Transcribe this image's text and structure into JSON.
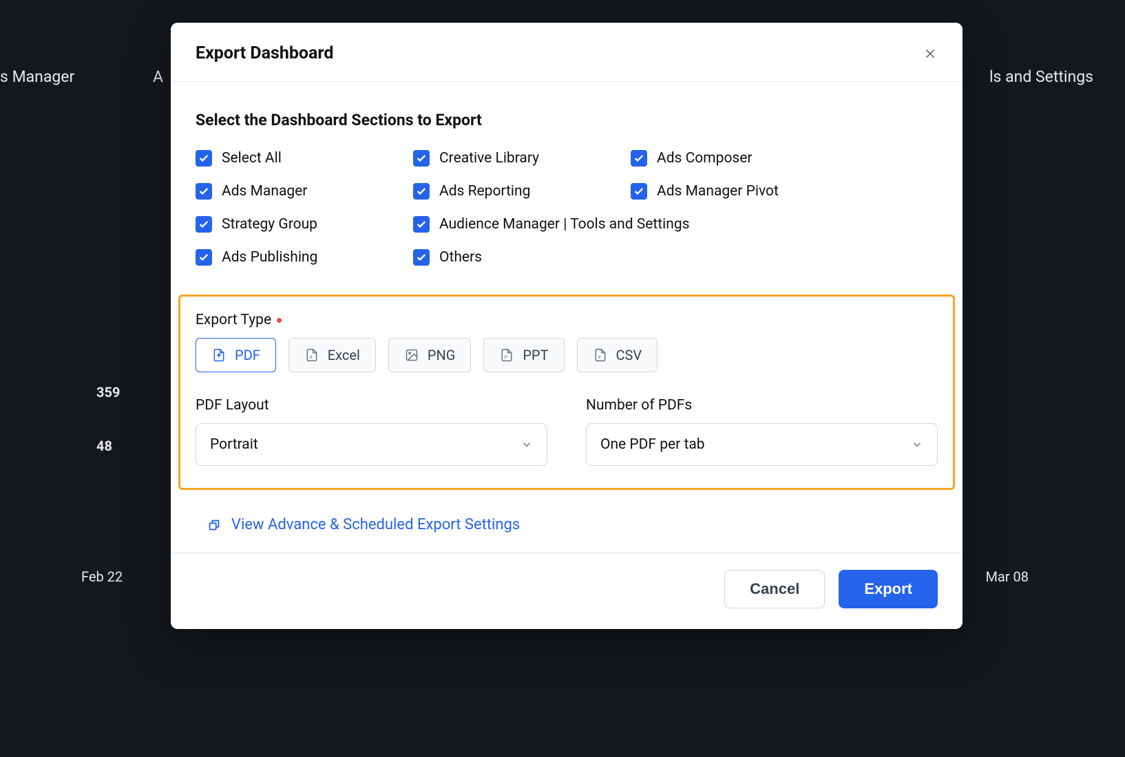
{
  "backdrop": {
    "left_text": "s Manager",
    "top_text": "A",
    "right_text": "ls and Settings",
    "value1": "359",
    "value2": "48",
    "date_left": "Feb 22",
    "date_right": "Mar 08"
  },
  "modal": {
    "title": "Export Dashboard",
    "sections_heading": "Select the Dashboard Sections to Export",
    "checkboxes": [
      {
        "label": "Select All",
        "checked": true
      },
      {
        "label": "Creative Library",
        "checked": true
      },
      {
        "label": "Ads Composer",
        "checked": true
      },
      {
        "label": "Ads Manager",
        "checked": true
      },
      {
        "label": "Ads Reporting",
        "checked": true
      },
      {
        "label": "Ads Manager Pivot",
        "checked": true
      },
      {
        "label": "Strategy Group",
        "checked": true
      },
      {
        "label": "Audience Manager | Tools and Settings",
        "checked": true,
        "wide": true
      },
      {
        "label": "Ads Publishing",
        "checked": true
      },
      {
        "label": "Others",
        "checked": true
      }
    ],
    "export_type": {
      "label": "Export Type",
      "options": [
        "PDF",
        "Excel",
        "PNG",
        "PPT",
        "CSV"
      ],
      "selected": "PDF"
    },
    "pdf_layout": {
      "label": "PDF Layout",
      "value": "Portrait"
    },
    "num_pdfs": {
      "label": "Number of PDFs",
      "value": "One PDF per tab"
    },
    "advanced_link": "View Advance & Scheduled Export Settings",
    "footer": {
      "cancel": "Cancel",
      "export": "Export"
    }
  }
}
